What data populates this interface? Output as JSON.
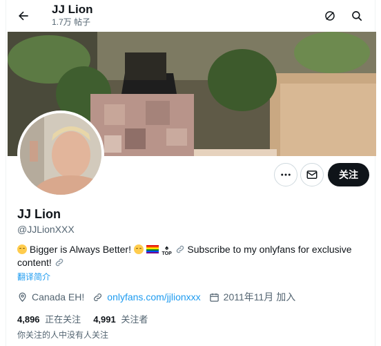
{
  "header": {
    "name": "JJ Lion",
    "post_count": "1.7万 帖子",
    "back_icon": "arrow-left-icon",
    "grok_icon": "grok-icon",
    "search_icon": "search-icon"
  },
  "profile": {
    "display_name": "JJ Lion",
    "handle": "@JJLionXXX",
    "bio_part1": "Bigger is Always Better!",
    "bio_part2": "Subscribe to my onlyfans for exclusive",
    "bio_part3": "content!",
    "top_label": "TOP",
    "translate_label": "翻译简介",
    "location": "Canada  EH!",
    "website": "onlyfans.com/jjlionxxx",
    "joined": "2011年11月 加入"
  },
  "actions": {
    "more_icon": "more-icon",
    "message_icon": "mail-icon",
    "follow_label": "关注"
  },
  "stats": {
    "following_count": "4,896",
    "following_label": "正在关注",
    "followers_count": "4,991",
    "followers_label": "关注者"
  },
  "followers_note": "你关注的人中没有人关注",
  "colors": {
    "accent": "#1d9bf0",
    "text": "#0f1419",
    "secondary": "#536471"
  }
}
